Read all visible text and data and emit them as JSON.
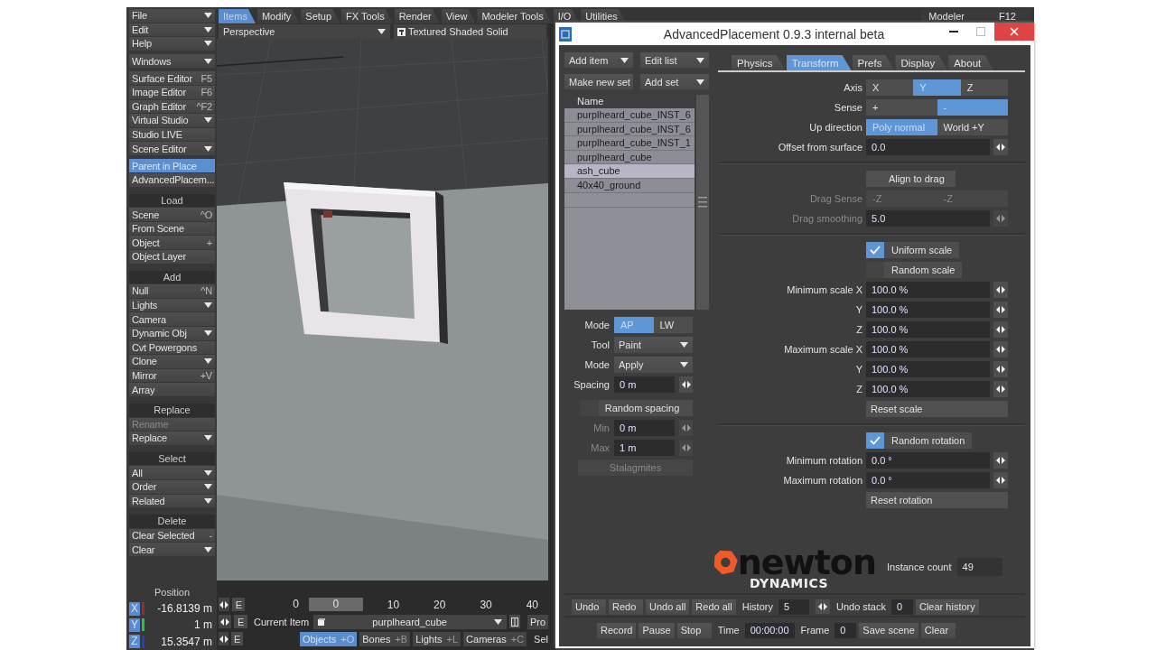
{
  "top_tabs": [
    {
      "label": "Items",
      "selected": true
    },
    {
      "label": "Modify",
      "selected": false
    },
    {
      "label": "Setup",
      "selected": false
    },
    {
      "label": "FX Tools",
      "selected": false
    },
    {
      "label": "Render",
      "selected": false
    },
    {
      "label": "View",
      "selected": false
    },
    {
      "label": "Modeler Tools",
      "selected": false
    },
    {
      "label": "I/O",
      "selected": false
    },
    {
      "label": "Utilities",
      "selected": false
    }
  ],
  "app_switch": {
    "label": "Modeler",
    "shortcut": "F12"
  },
  "sidebar": {
    "groups": [
      {
        "items": [
          {
            "label": "File",
            "kind": "dropdown",
            "selected": false,
            "disabled": false
          },
          {
            "label": "Edit",
            "kind": "dropdown",
            "selected": false,
            "disabled": false
          },
          {
            "label": "Help",
            "kind": "dropdown",
            "selected": false,
            "disabled": false
          }
        ]
      },
      {
        "items": [
          {
            "label": "Windows",
            "kind": "dropdown",
            "selected": false,
            "disabled": false
          }
        ]
      },
      {
        "items": [
          {
            "label": "Surface Editor",
            "kind": "button",
            "shortcut": "F5",
            "selected": false,
            "disabled": false
          },
          {
            "label": "Image Editor",
            "kind": "button",
            "shortcut": "F6",
            "selected": false,
            "disabled": false
          },
          {
            "label": "Graph Editor",
            "kind": "button",
            "shortcut": "^F2",
            "selected": false,
            "disabled": false
          },
          {
            "label": "Virtual Studio",
            "kind": "dropdown",
            "selected": false,
            "disabled": false
          },
          {
            "label": "Studio LIVE",
            "kind": "button",
            "selected": false,
            "disabled": false
          },
          {
            "label": "Scene Editor",
            "kind": "dropdown",
            "selected": false,
            "disabled": false
          }
        ]
      },
      {
        "items": [
          {
            "label": "Parent in Place",
            "kind": "button",
            "selected": true,
            "disabled": false
          },
          {
            "label": "AdvancedPlacem...",
            "kind": "button",
            "selected": false,
            "disabled": false
          }
        ]
      },
      {
        "heading": "Load",
        "items": [
          {
            "label": "Scene",
            "kind": "button",
            "shortcut": "^O",
            "selected": false,
            "disabled": false
          },
          {
            "label": "From Scene",
            "kind": "button",
            "selected": false,
            "disabled": false
          },
          {
            "label": "Object",
            "kind": "button",
            "shortcut": "+",
            "selected": false,
            "disabled": false
          },
          {
            "label": "Object Layer",
            "kind": "button",
            "selected": false,
            "disabled": false
          }
        ]
      },
      {
        "heading": "Add",
        "items": [
          {
            "label": "Null",
            "kind": "button",
            "shortcut": "^N",
            "selected": false,
            "disabled": false
          },
          {
            "label": "Lights",
            "kind": "dropdown",
            "selected": false,
            "disabled": false
          },
          {
            "label": "Camera",
            "kind": "button",
            "selected": false,
            "disabled": false
          },
          {
            "label": "Dynamic Obj",
            "kind": "dropdown",
            "selected": false,
            "disabled": false
          },
          {
            "label": "Cvt Powergons",
            "kind": "button",
            "selected": false,
            "disabled": false
          },
          {
            "label": "Clone",
            "kind": "dropdown",
            "selected": false,
            "disabled": false
          },
          {
            "label": "Mirror",
            "kind": "button",
            "shortcut": "+V",
            "selected": false,
            "disabled": false
          },
          {
            "label": "Array",
            "kind": "button",
            "selected": false,
            "disabled": false
          }
        ]
      },
      {
        "heading": "Replace",
        "items": [
          {
            "label": "Rename",
            "kind": "button",
            "selected": false,
            "disabled": true
          },
          {
            "label": "Replace",
            "kind": "dropdown",
            "selected": false,
            "disabled": false
          }
        ]
      },
      {
        "heading": "Select",
        "items": [
          {
            "label": "All",
            "kind": "dropdown",
            "selected": false,
            "disabled": false
          },
          {
            "label": "Order",
            "kind": "dropdown",
            "selected": false,
            "disabled": false
          },
          {
            "label": "Related",
            "kind": "dropdown",
            "selected": false,
            "disabled": false
          }
        ]
      },
      {
        "heading": "Delete",
        "items": [
          {
            "label": "Clear Selected",
            "kind": "button",
            "shortcut": "-",
            "selected": false,
            "disabled": false
          },
          {
            "label": "Clear",
            "kind": "dropdown",
            "selected": false,
            "disabled": false
          }
        ]
      }
    ]
  },
  "position": {
    "label": "Position",
    "axes": [
      {
        "axis": "X",
        "color": "#a02828",
        "value": "-16.8139 m",
        "envelope": "E"
      },
      {
        "axis": "Y",
        "color": "#30c040",
        "value": "1 m",
        "envelope": "E"
      },
      {
        "axis": "Z",
        "color": "#2840b0",
        "value": "15.3547 m",
        "envelope": "E"
      }
    ]
  },
  "viewport": {
    "view": "Perspective",
    "shading": "Textured Shaded Solid"
  },
  "timeline": {
    "start": "0",
    "current": "0",
    "ticks": [
      "10",
      "20",
      "30",
      "40"
    ]
  },
  "current_item": {
    "label": "Current Item",
    "value": "purplheard_cube",
    "next_button": "Pro"
  },
  "item_types": [
    {
      "label": "Objects",
      "shortcut": "+O",
      "selected": true
    },
    {
      "label": "Bones",
      "shortcut": "+B",
      "selected": false
    },
    {
      "label": "Lights",
      "shortcut": "+L",
      "selected": false
    },
    {
      "label": "Cameras",
      "shortcut": "+C",
      "selected": false
    }
  ],
  "select_label": "Sel",
  "plugin": {
    "title": "AdvancedPlacement 0.9.3 internal beta",
    "list_buttons": [
      {
        "label": "Add item",
        "kind": "dropdown"
      },
      {
        "label": "Edit list",
        "kind": "dropdown"
      },
      {
        "label": "Make new set",
        "kind": "button"
      },
      {
        "label": "Add set",
        "kind": "dropdown"
      }
    ],
    "list": {
      "column": "Name",
      "rows": [
        {
          "name": "purplheard_cube_INST_6",
          "selected": false
        },
        {
          "name": "purplheard_cube_INST_6",
          "selected": false
        },
        {
          "name": "purplheard_cube_INST_1",
          "selected": false
        },
        {
          "name": "purplheard_cube",
          "selected": false
        },
        {
          "name": "ash_cube",
          "selected": true
        },
        {
          "name": "40x40_ground",
          "selected": false
        }
      ]
    },
    "controls": [
      {
        "kind": "segmented",
        "label": "Mode",
        "disabled": false,
        "options": [
          {
            "label": "AP",
            "selected": true
          },
          {
            "label": "LW",
            "selected": false
          }
        ]
      },
      {
        "kind": "dropdown",
        "label": "Tool",
        "value": "Paint"
      },
      {
        "kind": "dropdown",
        "label": "Mode",
        "value": "Apply"
      },
      {
        "kind": "number",
        "label": "Spacing",
        "value": "0 m",
        "disabled": false
      },
      {
        "kind": "checkbox",
        "label": "Random spacing",
        "checked": false
      },
      {
        "kind": "number",
        "label": "Min",
        "value": "0 m",
        "disabled": true
      },
      {
        "kind": "number",
        "label": "Max",
        "value": "1 m",
        "disabled": true
      },
      {
        "kind": "button",
        "label": "Stalagmites",
        "disabled": true
      }
    ],
    "tabs": [
      {
        "label": "Physics",
        "selected": false
      },
      {
        "label": "Transform",
        "selected": true
      },
      {
        "label": "Prefs",
        "selected": false
      },
      {
        "label": "Display",
        "selected": false
      },
      {
        "label": "About",
        "selected": false
      }
    ],
    "sections": [
      [
        {
          "kind": "segmented",
          "label": "Axis",
          "disabled": false,
          "options": [
            {
              "label": "X",
              "selected": false
            },
            {
              "label": "Y",
              "selected": true
            },
            {
              "label": "Z",
              "selected": false
            }
          ]
        },
        {
          "kind": "segmented",
          "label": "Sense",
          "disabled": false,
          "options": [
            {
              "label": "+",
              "selected": false
            },
            {
              "label": "-",
              "selected": true
            }
          ]
        },
        {
          "kind": "segmented",
          "label": "Up direction",
          "disabled": false,
          "options": [
            {
              "label": "Poly normal",
              "selected": true
            },
            {
              "label": "World +Y",
              "selected": false
            }
          ]
        },
        {
          "kind": "number",
          "label": "Offset from surface",
          "value": "0.0",
          "disabled": false
        }
      ],
      [
        {
          "kind": "button",
          "label": "Align to drag",
          "disabled": false
        },
        {
          "kind": "segmented",
          "label": "Drag Sense",
          "disabled": true,
          "options": [
            {
              "label": "-Z",
              "selected": false
            },
            {
              "label": "-Z",
              "selected": false
            }
          ]
        },
        {
          "kind": "number",
          "label": "Drag smoothing",
          "value": "5.0",
          "disabled": true
        }
      ],
      [
        {
          "kind": "checkbox",
          "label": "Uniform scale",
          "checked": true
        },
        {
          "kind": "checkbox",
          "label": "Random scale",
          "checked": false
        },
        {
          "kind": "number",
          "label": "Minimum scale X",
          "value": "100.0 %",
          "disabled": false
        },
        {
          "kind": "number",
          "label": "Y",
          "value": "100.0 %",
          "disabled": false
        },
        {
          "kind": "number",
          "label": "Z",
          "value": "100.0 %",
          "disabled": false
        },
        {
          "kind": "number",
          "label": "Maximum scale X",
          "value": "100.0 %",
          "disabled": false
        },
        {
          "kind": "number",
          "label": "Y",
          "value": "100.0 %",
          "disabled": false
        },
        {
          "kind": "number",
          "label": "Z",
          "value": "100.0 %",
          "disabled": false
        },
        {
          "kind": "widebutton",
          "label": "Reset scale",
          "disabled": false
        }
      ],
      [
        {
          "kind": "checkbox",
          "label": "Random rotation",
          "checked": true
        },
        {
          "kind": "number",
          "label": "Minimum rotation",
          "value": "0.0 °",
          "disabled": false
        },
        {
          "kind": "number",
          "label": "Maximum rotation",
          "value": "0.0 °",
          "disabled": false
        },
        {
          "kind": "widebutton",
          "label": "Reset rotation",
          "disabled": false
        }
      ]
    ],
    "logo": {
      "word": "newton",
      "subtitle": "DYNAMICS"
    },
    "instance_count": {
      "label": "Instance count",
      "value": "49"
    },
    "history_row": [
      {
        "kind": "button",
        "label": "Undo"
      },
      {
        "kind": "button",
        "label": "Redo"
      },
      {
        "kind": "button",
        "label": "Undo all"
      },
      {
        "kind": "button",
        "label": "Redo all"
      },
      {
        "kind": "spinner",
        "label": "History",
        "value": "5"
      },
      {
        "kind": "field",
        "label": "Undo stack",
        "value": "0"
      },
      {
        "kind": "button",
        "label": "Clear history"
      }
    ],
    "record_row": [
      {
        "kind": "button",
        "label": "Record"
      },
      {
        "kind": "button",
        "label": "Pause"
      },
      {
        "kind": "button",
        "label": "Stop"
      },
      {
        "kind": "field",
        "label": "Time",
        "value": "00:00:00"
      },
      {
        "kind": "field",
        "label": "Frame",
        "value": "0"
      },
      {
        "kind": "button",
        "label": "Save scene"
      },
      {
        "kind": "button",
        "label": "Clear"
      }
    ]
  }
}
